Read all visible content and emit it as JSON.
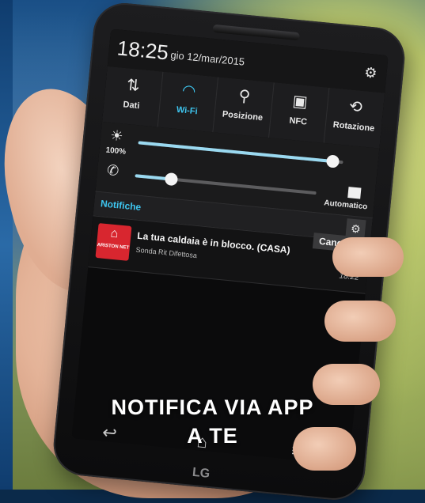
{
  "status": {
    "time": "18:25",
    "date": "gio 12/mar/2015"
  },
  "quick_settings": [
    {
      "label": "Dati",
      "icon": "data-icon",
      "active": false
    },
    {
      "label": "Wi-Fi",
      "icon": "wifi-icon",
      "active": true
    },
    {
      "label": "Posizione",
      "icon": "location-icon",
      "active": false
    },
    {
      "label": "NFC",
      "icon": "nfc-icon",
      "active": false
    },
    {
      "label": "Rotazione",
      "icon": "rotation-icon",
      "active": false
    }
  ],
  "brightness": {
    "percent_label": "100%",
    "level": 1.0,
    "auto_label": "Automatico"
  },
  "volume": {
    "level": 0.2
  },
  "notifications": {
    "header": "Notifiche",
    "clear_label": "Cancella",
    "items": [
      {
        "app_name": "ARISTON NET",
        "title": "La tua caldaia è in blocco. (CASA)",
        "subtitle": "Sonda Rit Difettosa",
        "time": "18:22"
      }
    ]
  },
  "device": {
    "brand": "LG"
  },
  "caption": {
    "line1": "NOTIFICA VIA APP",
    "line2": "A TE"
  },
  "colors": {
    "accent": "#3ec6f0",
    "app_icon": "#d8262f"
  }
}
